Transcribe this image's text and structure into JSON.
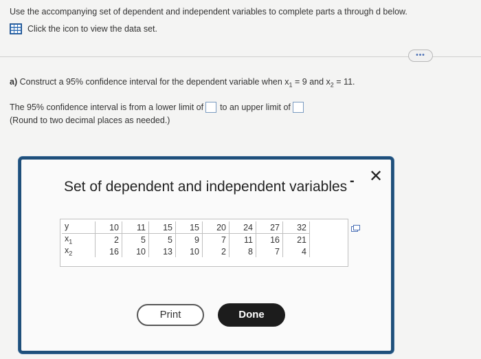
{
  "instruction": "Use the accompanying set of dependent and independent variables to complete parts a through d below.",
  "dataset_link": {
    "label": "Click the icon to view the data set."
  },
  "more_button": {
    "label": "•••"
  },
  "part_a": {
    "prefix": "a)",
    "text": "Construct a 95% confidence interval for the dependent variable when x",
    "sub1": "1",
    "mid": " = 9 and x",
    "sub2": "2",
    "end": " = 11."
  },
  "answer": {
    "before": "The 95% confidence interval is from a lower limit of",
    "middle": "to an upper limit of",
    "lower_value": "",
    "upper_value": ""
  },
  "round_note": "(Round to two decimal places as needed.)",
  "modal": {
    "title": "Set of dependent and independent variables",
    "minimize": "-",
    "close": "✕",
    "table": {
      "rows": [
        {
          "label": "y",
          "sub": "",
          "values": [
            "10",
            "11",
            "15",
            "15",
            "20",
            "24",
            "27",
            "32"
          ]
        },
        {
          "label": "x",
          "sub": "1",
          "values": [
            "2",
            "5",
            "5",
            "9",
            "7",
            "11",
            "16",
            "21"
          ]
        },
        {
          "label": "x",
          "sub": "2",
          "values": [
            "16",
            "10",
            "13",
            "10",
            "2",
            "8",
            "7",
            "4"
          ]
        }
      ]
    },
    "print_label": "Print",
    "done_label": "Done"
  }
}
